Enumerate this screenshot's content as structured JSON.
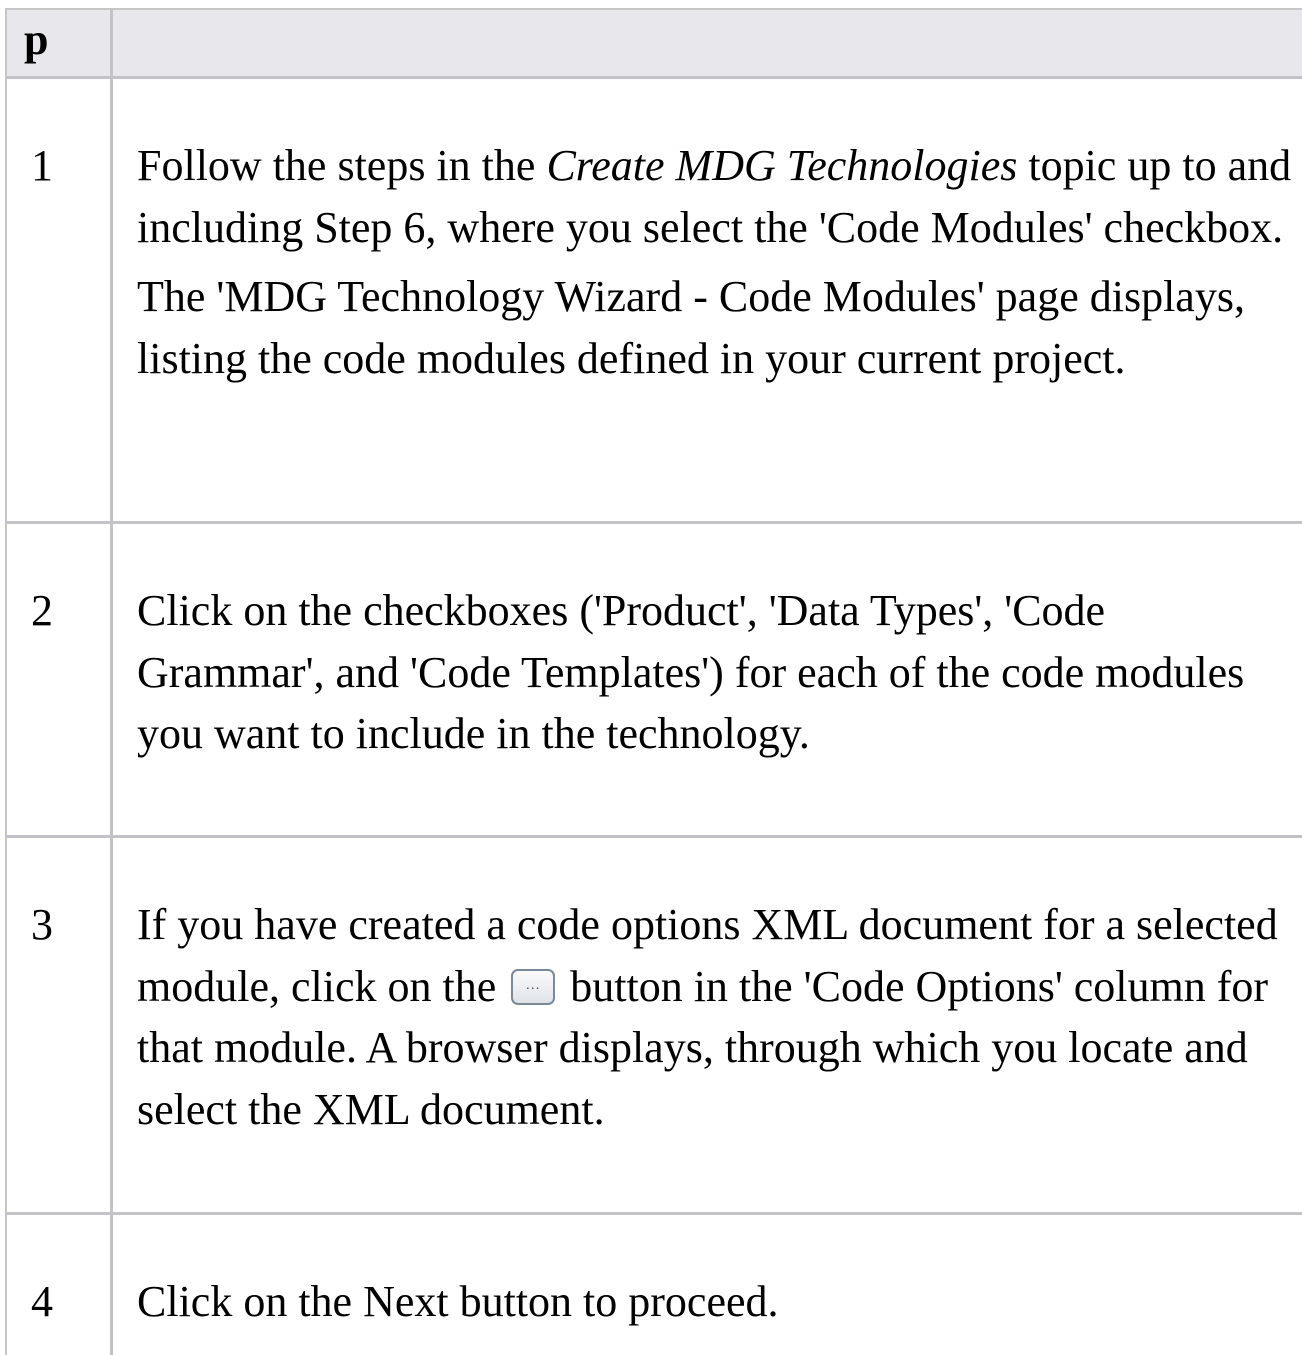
{
  "table": {
    "header_col1": "p",
    "header_col2": "",
    "rows": [
      {
        "number": "1",
        "p1_a": "Follow the steps in the ",
        "p1_em": "Create MDG Technologies",
        "p1_b": " topic up to and including Step 6, where you select the 'Code Modules' checkbox.",
        "p2": "The 'MDG Technology Wizard - Code Modules' page displays, listing the code modules defined in your current project."
      },
      {
        "number": "2",
        "p1": "Click on the checkboxes ('Product', 'Data Types', 'Code Grammar', and 'Code Templates') for each of the code modules you want to include in the technology."
      },
      {
        "number": "3",
        "p1_a": "If you have created a code options XML document for a selected module, click on the",
        "button_icon": "ellipsis-button-icon",
        "p1_b": "button in the 'Code Options' column for that module. A browser displays, through which you locate and select the XML document."
      },
      {
        "number": "4",
        "p1": "Click on the Next button to proceed."
      }
    ]
  }
}
